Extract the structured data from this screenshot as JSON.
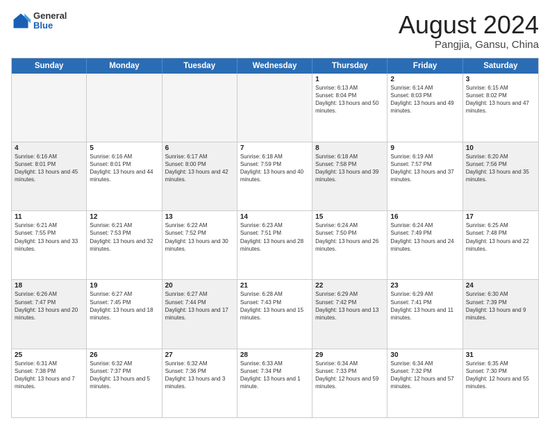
{
  "header": {
    "logo": {
      "general": "General",
      "blue": "Blue"
    },
    "title": "August 2024",
    "subtitle": "Pangjia, Gansu, China"
  },
  "calendar": {
    "days_of_week": [
      "Sunday",
      "Monday",
      "Tuesday",
      "Wednesday",
      "Thursday",
      "Friday",
      "Saturday"
    ],
    "rows": [
      [
        {
          "day": "",
          "empty": true
        },
        {
          "day": "",
          "empty": true
        },
        {
          "day": "",
          "empty": true
        },
        {
          "day": "",
          "empty": true
        },
        {
          "day": "1",
          "sunrise": "6:13 AM",
          "sunset": "8:04 PM",
          "daylight": "13 hours and 50 minutes."
        },
        {
          "day": "2",
          "sunrise": "6:14 AM",
          "sunset": "8:03 PM",
          "daylight": "13 hours and 49 minutes."
        },
        {
          "day": "3",
          "sunrise": "6:15 AM",
          "sunset": "8:02 PM",
          "daylight": "13 hours and 47 minutes."
        }
      ],
      [
        {
          "day": "4",
          "sunrise": "6:16 AM",
          "sunset": "8:01 PM",
          "daylight": "13 hours and 45 minutes.",
          "shaded": true
        },
        {
          "day": "5",
          "sunrise": "6:16 AM",
          "sunset": "8:01 PM",
          "daylight": "13 hours and 44 minutes."
        },
        {
          "day": "6",
          "sunrise": "6:17 AM",
          "sunset": "8:00 PM",
          "daylight": "13 hours and 42 minutes.",
          "shaded": true
        },
        {
          "day": "7",
          "sunrise": "6:18 AM",
          "sunset": "7:59 PM",
          "daylight": "13 hours and 40 minutes."
        },
        {
          "day": "8",
          "sunrise": "6:18 AM",
          "sunset": "7:58 PM",
          "daylight": "13 hours and 39 minutes.",
          "shaded": true
        },
        {
          "day": "9",
          "sunrise": "6:19 AM",
          "sunset": "7:57 PM",
          "daylight": "13 hours and 37 minutes."
        },
        {
          "day": "10",
          "sunrise": "6:20 AM",
          "sunset": "7:56 PM",
          "daylight": "13 hours and 35 minutes.",
          "shaded": true
        }
      ],
      [
        {
          "day": "11",
          "sunrise": "6:21 AM",
          "sunset": "7:55 PM",
          "daylight": "13 hours and 33 minutes."
        },
        {
          "day": "12",
          "sunrise": "6:21 AM",
          "sunset": "7:53 PM",
          "daylight": "13 hours and 32 minutes.",
          "shaded": false
        },
        {
          "day": "13",
          "sunrise": "6:22 AM",
          "sunset": "7:52 PM",
          "daylight": "13 hours and 30 minutes."
        },
        {
          "day": "14",
          "sunrise": "6:23 AM",
          "sunset": "7:51 PM",
          "daylight": "13 hours and 28 minutes."
        },
        {
          "day": "15",
          "sunrise": "6:24 AM",
          "sunset": "7:50 PM",
          "daylight": "13 hours and 26 minutes."
        },
        {
          "day": "16",
          "sunrise": "6:24 AM",
          "sunset": "7:49 PM",
          "daylight": "13 hours and 24 minutes."
        },
        {
          "day": "17",
          "sunrise": "6:25 AM",
          "sunset": "7:48 PM",
          "daylight": "13 hours and 22 minutes."
        }
      ],
      [
        {
          "day": "18",
          "sunrise": "6:26 AM",
          "sunset": "7:47 PM",
          "daylight": "13 hours and 20 minutes.",
          "shaded": true
        },
        {
          "day": "19",
          "sunrise": "6:27 AM",
          "sunset": "7:45 PM",
          "daylight": "13 hours and 18 minutes."
        },
        {
          "day": "20",
          "sunrise": "6:27 AM",
          "sunset": "7:44 PM",
          "daylight": "13 hours and 17 minutes.",
          "shaded": true
        },
        {
          "day": "21",
          "sunrise": "6:28 AM",
          "sunset": "7:43 PM",
          "daylight": "13 hours and 15 minutes."
        },
        {
          "day": "22",
          "sunrise": "6:29 AM",
          "sunset": "7:42 PM",
          "daylight": "13 hours and 13 minutes.",
          "shaded": true
        },
        {
          "day": "23",
          "sunrise": "6:29 AM",
          "sunset": "7:41 PM",
          "daylight": "13 hours and 11 minutes."
        },
        {
          "day": "24",
          "sunrise": "6:30 AM",
          "sunset": "7:39 PM",
          "daylight": "13 hours and 9 minutes.",
          "shaded": true
        }
      ],
      [
        {
          "day": "25",
          "sunrise": "6:31 AM",
          "sunset": "7:38 PM",
          "daylight": "13 hours and 7 minutes."
        },
        {
          "day": "26",
          "sunrise": "6:32 AM",
          "sunset": "7:37 PM",
          "daylight": "13 hours and 5 minutes."
        },
        {
          "day": "27",
          "sunrise": "6:32 AM",
          "sunset": "7:36 PM",
          "daylight": "13 hours and 3 minutes."
        },
        {
          "day": "28",
          "sunrise": "6:33 AM",
          "sunset": "7:34 PM",
          "daylight": "13 hours and 1 minute."
        },
        {
          "day": "29",
          "sunrise": "6:34 AM",
          "sunset": "7:33 PM",
          "daylight": "12 hours and 59 minutes."
        },
        {
          "day": "30",
          "sunrise": "6:34 AM",
          "sunset": "7:32 PM",
          "daylight": "12 hours and 57 minutes."
        },
        {
          "day": "31",
          "sunrise": "6:35 AM",
          "sunset": "7:30 PM",
          "daylight": "12 hours and 55 minutes."
        }
      ]
    ]
  }
}
